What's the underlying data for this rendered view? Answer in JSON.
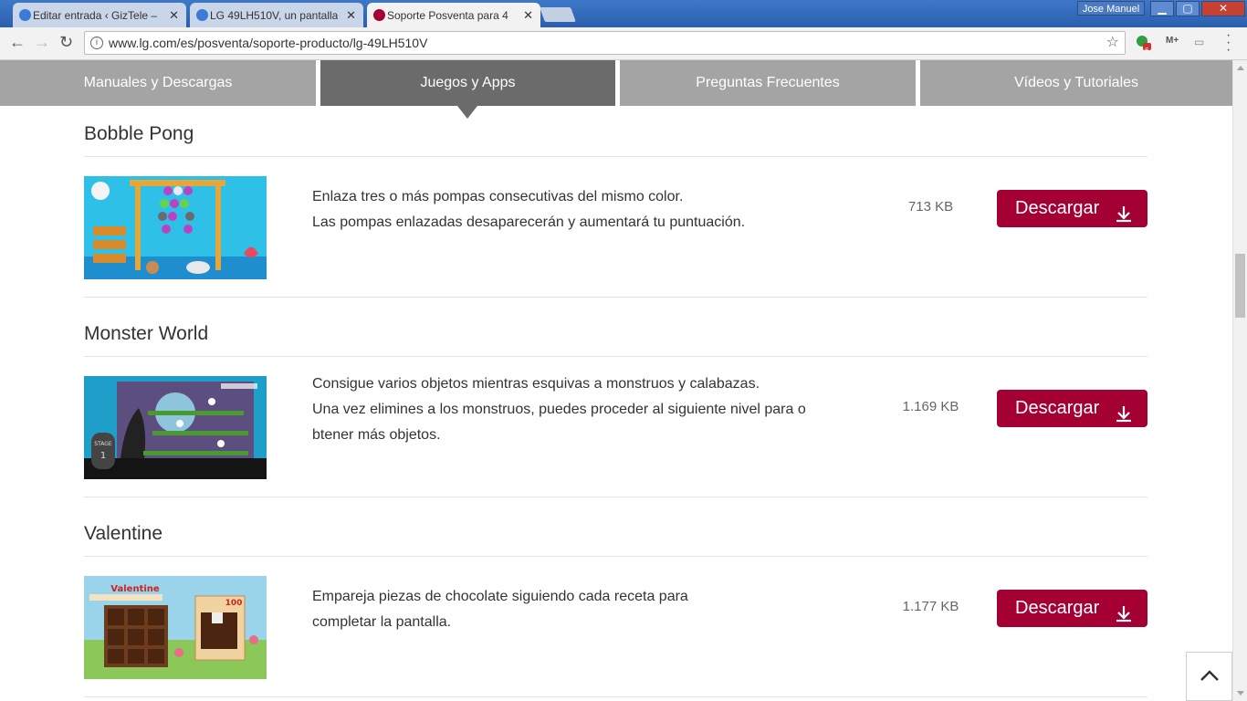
{
  "browser": {
    "tabs": [
      {
        "label": "Editar entrada ‹ GizTele –",
        "favicon_color": "#3b7ad6"
      },
      {
        "label": "LG 49LH510V, un pantalla",
        "favicon_color": "#3b7ad6"
      },
      {
        "label": "Soporte Posventa para 4",
        "favicon_color": "#a50034"
      }
    ],
    "user": "Jose Manuel",
    "url": "www.lg.com/es/posventa/soporte-producto/lg-49LH510V",
    "extension_badge": "6",
    "ext_label": "M+"
  },
  "nav_tabs": [
    {
      "label": "Manuales y Descargas",
      "active": false
    },
    {
      "label": "Juegos y Apps",
      "active": true
    },
    {
      "label": "Preguntas Frecuentes",
      "active": false
    },
    {
      "label": "Vídeos y Tutoriales",
      "active": false
    }
  ],
  "apps": [
    {
      "title": "Bobble Pong",
      "desc_lines": [
        "Enlaza tres o más pompas consecutivas del mismo color.",
        "Las pompas enlazadas desaparecerán y aumentará tu puntuación."
      ],
      "size": "713 KB",
      "download_label": "Descargar"
    },
    {
      "title": "Monster World",
      "desc_lines": [
        "Consigue varios objetos mientras esquivas a monstruos y calabazas.",
        "Una vez elimines a los monstruos, puedes proceder al siguiente nivel para o",
        "btener más objetos."
      ],
      "size": "1.169 KB",
      "download_label": "Descargar",
      "thumb_text": "STAGE 1"
    },
    {
      "title": "Valentine",
      "desc_lines": [
        "Empareja piezas de chocolate siguiendo cada receta para",
        "completar la pantalla."
      ],
      "size": "1.177 KB",
      "download_label": "Descargar",
      "thumb_text": "Valentine",
      "thumb_score": "100"
    }
  ],
  "colors": {
    "accent": "#a50034",
    "tab_bg": "#a4a4a4",
    "tab_active": "#6b6b6b"
  }
}
